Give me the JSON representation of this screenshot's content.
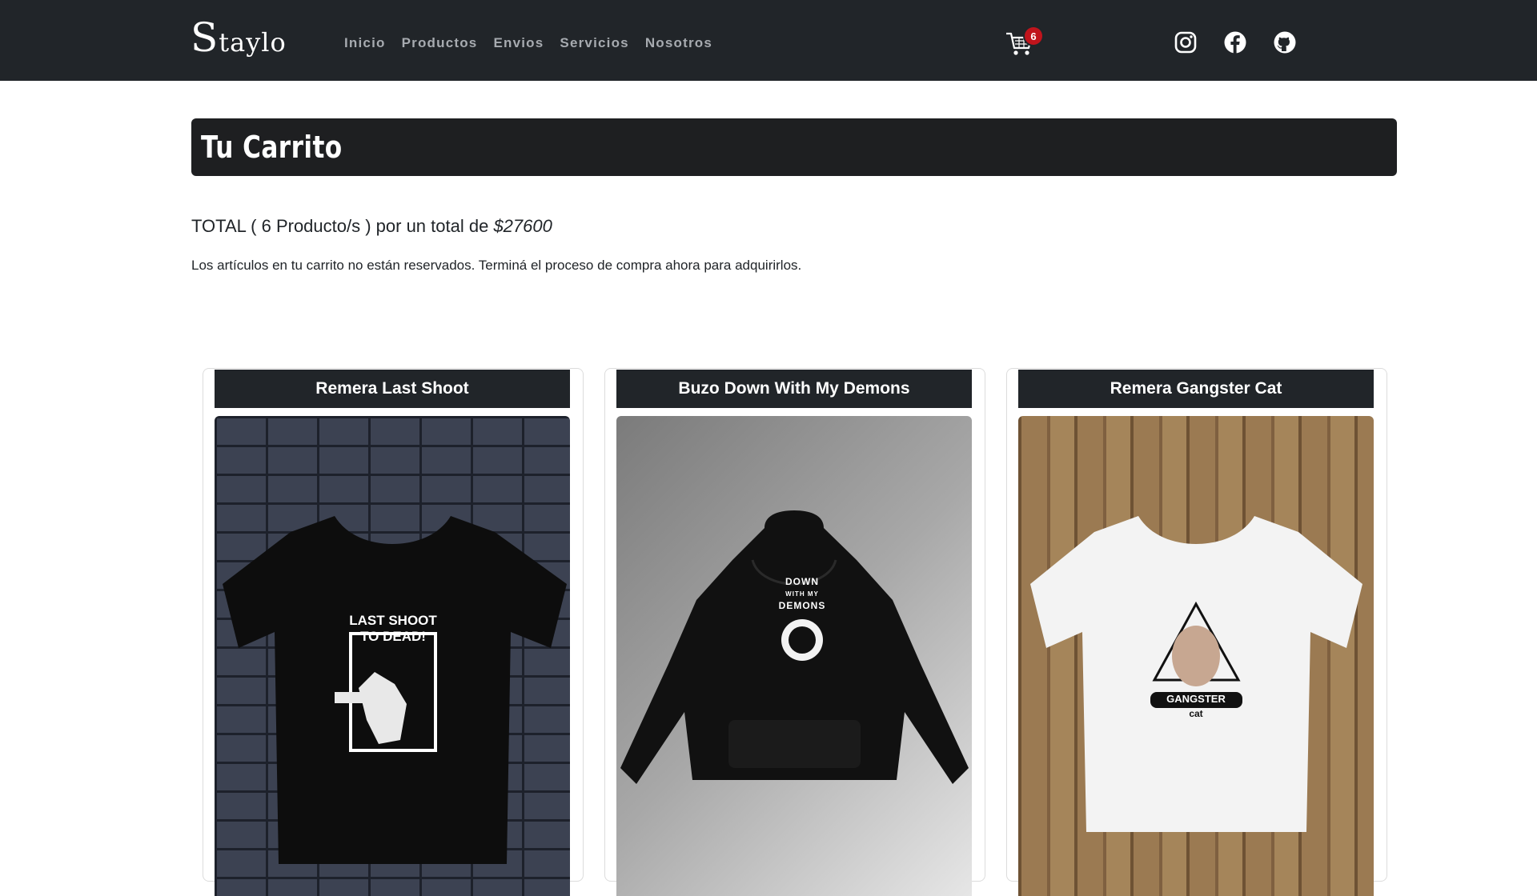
{
  "nav": {
    "brand_initial": "S",
    "brand_rest": "taylo",
    "links": [
      "Inicio",
      "Productos",
      "Envios",
      "Servicios",
      "Nosotros"
    ],
    "cart_icon": "cart-icon",
    "cart_count": "6",
    "social": [
      "instagram-icon",
      "facebook-icon",
      "github-icon"
    ]
  },
  "page": {
    "title": "Tu Carrito",
    "total_prefix": "TOTAL ( 6 Producto/s ) por un total de ",
    "total_amount": "$27600",
    "notice": "Los artículos en tu carrito no están reservados. Terminá el proceso de compra ahora para adquirirlos."
  },
  "products": [
    {
      "name": "Remera Last Shoot",
      "print_lines": [
        "LAST SHOOT",
        "TO DEAD!"
      ]
    },
    {
      "name": "Buzo Down With My Demons",
      "print_lines": [
        "DOWN",
        "WITH MY",
        "DEMONS"
      ]
    },
    {
      "name": "Remera Gangster Cat",
      "print_lines": [
        "GANGSTER",
        "cat"
      ]
    }
  ],
  "colors": {
    "navbar": "#212529",
    "badge": "#c0141c",
    "banner": "#1e1f21"
  }
}
